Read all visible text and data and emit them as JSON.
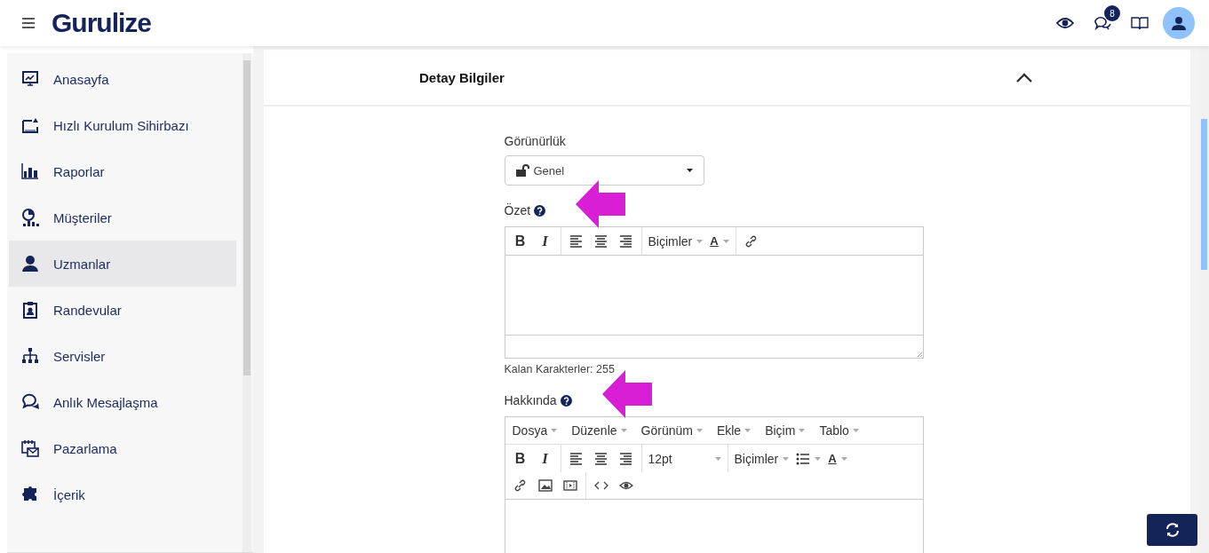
{
  "header": {
    "logo": "Gurulize",
    "notification_count": "8"
  },
  "sidebar": {
    "items": [
      {
        "label": "Anasayfa",
        "selected": false
      },
      {
        "label": "Hızlı Kurulum Sihirbazı",
        "selected": false
      },
      {
        "label": "Raporlar",
        "selected": false
      },
      {
        "label": "Müşteriler",
        "selected": false
      },
      {
        "label": "Uzmanlar",
        "selected": true
      },
      {
        "label": "Randevular",
        "selected": false
      },
      {
        "label": "Servisler",
        "selected": false
      },
      {
        "label": "Anlık Mesajlaşma",
        "selected": false
      },
      {
        "label": "Pazarlama",
        "selected": false
      },
      {
        "label": "İçerik",
        "selected": false
      }
    ]
  },
  "section": {
    "title": "Detay Bilgiler",
    "expanded": true
  },
  "fields": [
    {
      "kind": "select",
      "label": "Görünürlük",
      "value": "Genel"
    },
    {
      "kind": "editor",
      "label": "Özet",
      "help": true,
      "annotated": true,
      "toolbar_rows": [
        [
          [
            {
              "kind": "bold",
              "label": "B"
            },
            {
              "kind": "italic",
              "label": "I"
            }
          ],
          [
            {
              "kind": "align-left"
            },
            {
              "kind": "align-center"
            },
            {
              "kind": "align-right"
            }
          ],
          [
            {
              "kind": "dropdown",
              "label": "Biçimler"
            },
            {
              "kind": "color",
              "label": "A"
            }
          ],
          [
            {
              "kind": "link"
            }
          ]
        ]
      ],
      "counter": "Kalan Karakterler: 255"
    },
    {
      "kind": "editor",
      "label": "Hakkında",
      "help": true,
      "annotated": true,
      "menus": [
        "Dosya",
        "Düzenle",
        "Görünüm",
        "Ekle",
        "Biçim",
        "Tablo"
      ],
      "toolbar_rows": [
        [
          [
            {
              "kind": "bold",
              "label": "B"
            },
            {
              "kind": "italic",
              "label": "I"
            }
          ],
          [
            {
              "kind": "align-left"
            },
            {
              "kind": "align-center"
            },
            {
              "kind": "align-right"
            }
          ],
          [
            {
              "kind": "select",
              "label": "12pt"
            }
          ],
          [
            {
              "kind": "dropdown",
              "label": "Biçimler"
            },
            {
              "kind": "list"
            },
            {
              "kind": "color",
              "label": "A"
            }
          ]
        ],
        [
          [
            {
              "kind": "link"
            },
            {
              "kind": "image"
            },
            {
              "kind": "media"
            }
          ],
          [
            {
              "kind": "code"
            },
            {
              "kind": "preview"
            }
          ]
        ]
      ]
    }
  ]
}
